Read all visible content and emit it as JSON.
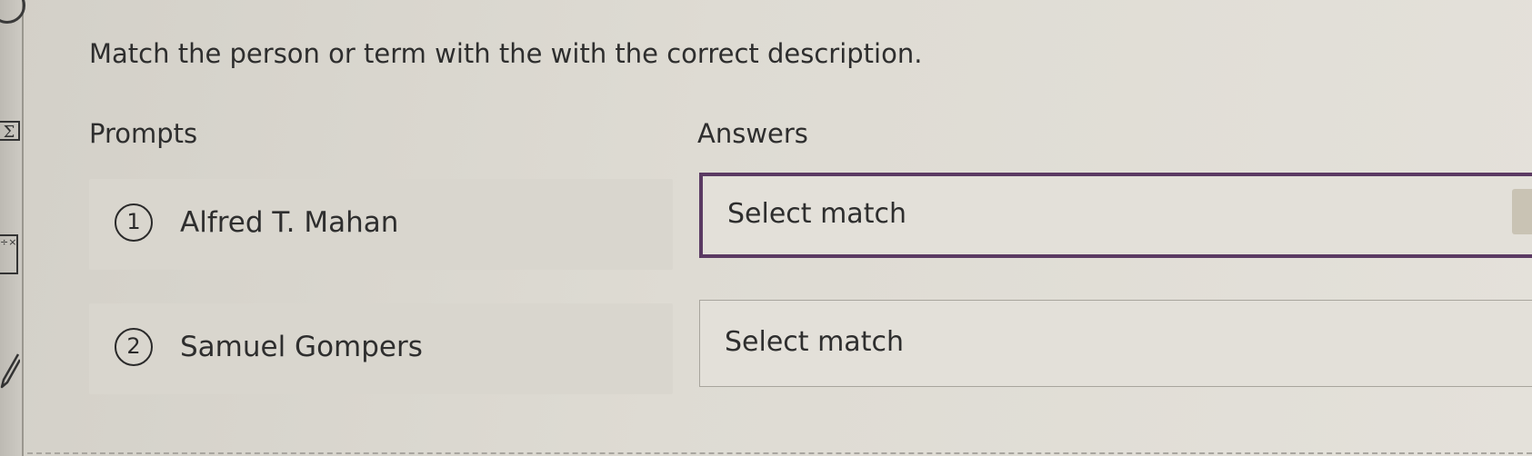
{
  "question": {
    "text": "Match the person or term with the with the correct description."
  },
  "columns": {
    "prompts_label": "Prompts",
    "answers_label": "Answers"
  },
  "prompts": [
    {
      "number": "1",
      "label": "Alfred T. Mahan"
    },
    {
      "number": "2",
      "label": "Samuel Gompers"
    }
  ],
  "answers": [
    {
      "placeholder": "Select match",
      "focused": true
    },
    {
      "placeholder": "Select match",
      "focused": false
    }
  ],
  "toolbar": {
    "icons": [
      "clock-icon",
      "sigma-icon",
      "calculator-icon",
      "pencil-icon"
    ],
    "sigma_glyph": "Σ",
    "calc_glyph": "÷×"
  },
  "colors": {
    "focus_border": "#5b3a63",
    "prompt_background": "#d9d6ce",
    "text": "#2e2e2e"
  }
}
